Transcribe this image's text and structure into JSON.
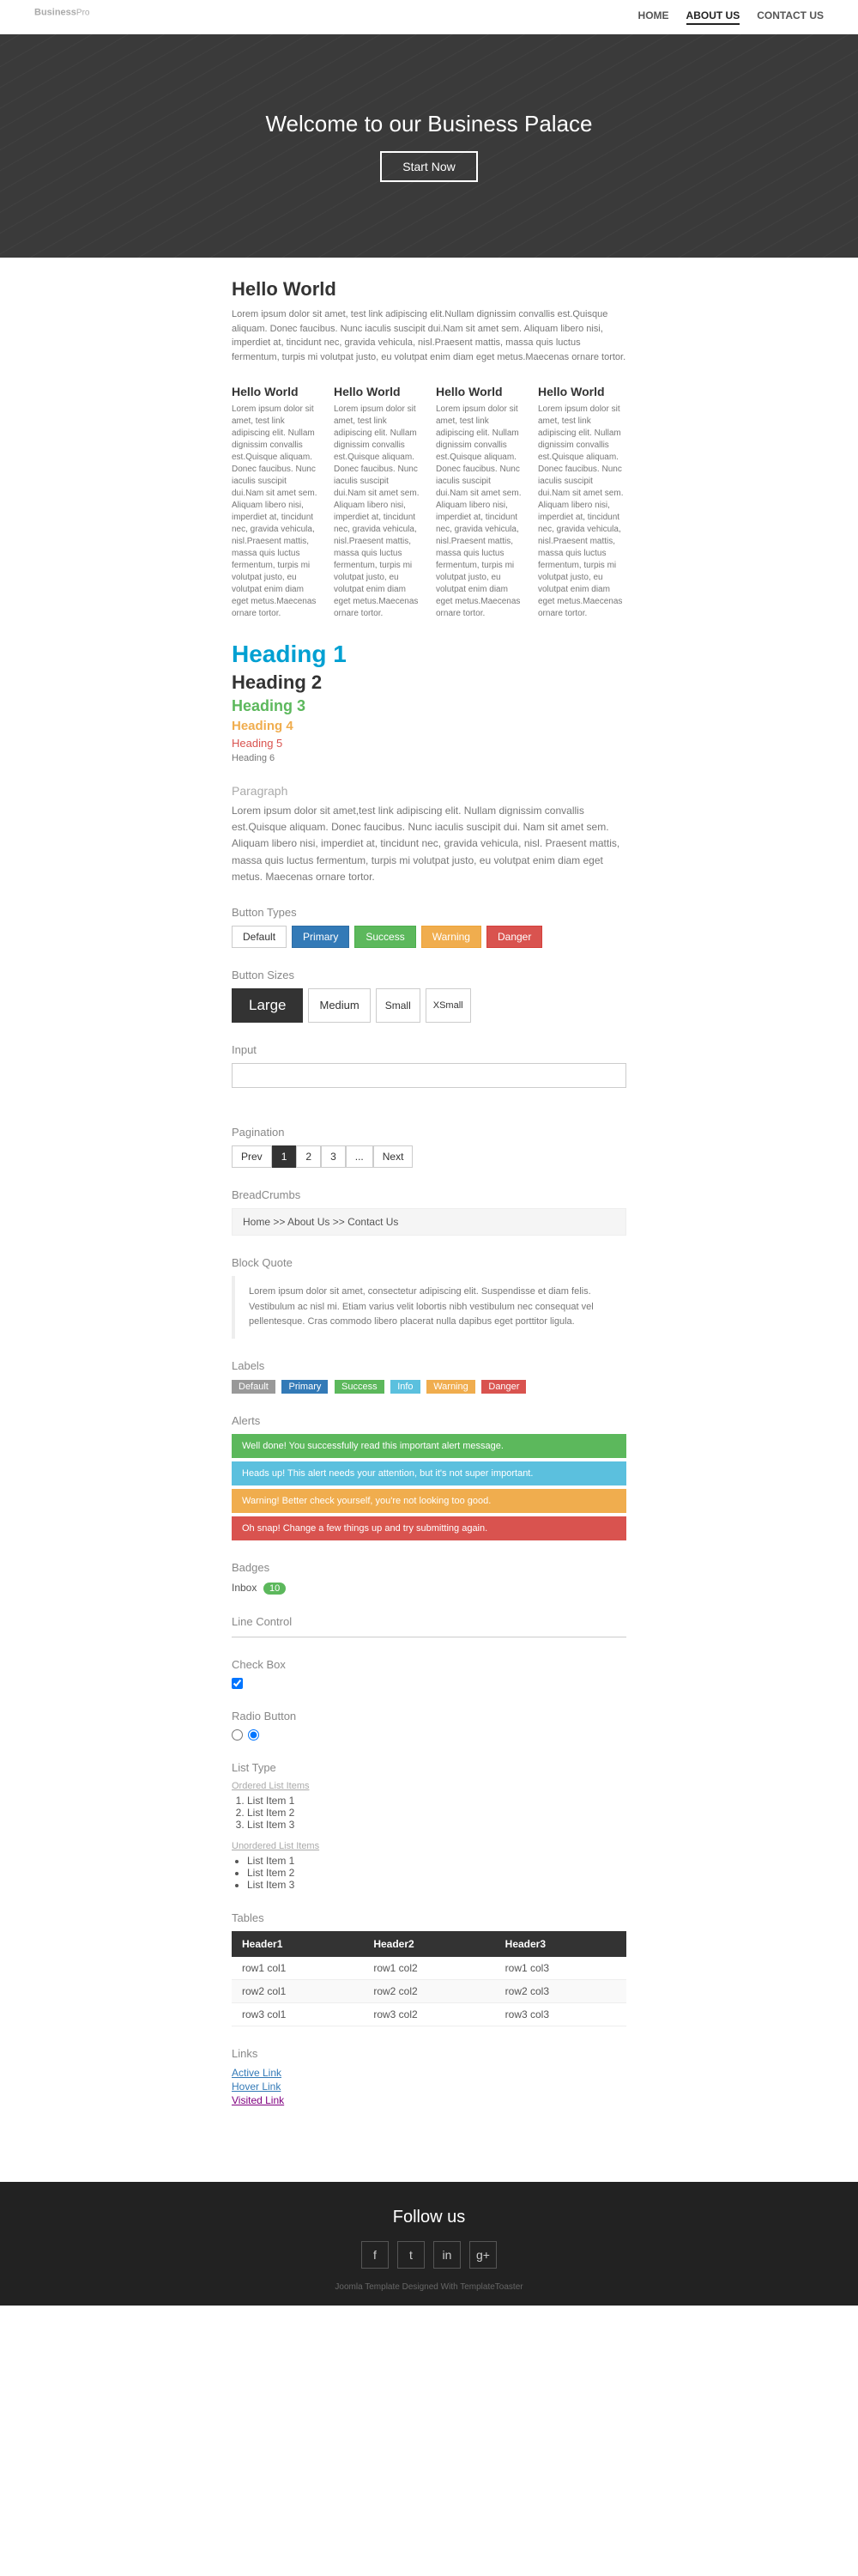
{
  "navbar": {
    "brand": "Business",
    "brand_sup": "Pro",
    "nav_items": [
      {
        "label": "HOME",
        "active": false
      },
      {
        "label": "ABOUT US",
        "active": true
      },
      {
        "label": "CONTACT US",
        "active": false
      }
    ]
  },
  "hero": {
    "title": "Welcome to our Business Palace",
    "button_label": "Start Now"
  },
  "hello_world": {
    "title": "Hello World",
    "intro_text": "Lorem ipsum dolor sit amet, test link adipiscing elit.Nullam dignissim convallis est.Quisque aliquam. Donec faucibus. Nunc iaculis suscipit dui.Nam sit amet sem. Aliquam libero nisi, imperdiet at, tincidunt nec, gravida vehicula, nisl.Praesent mattis, massa quis luctus fermentum, turpis mi volutpat justo, eu volutpat enim diam eget metus.Maecenas ornare tortor.",
    "columns": [
      {
        "title": "Hello World",
        "text": "Lorem ipsum dolor sit amet, test link adipiscing elit. Nullam dignissim convallis est.Quisque aliquam. Donec faucibus. Nunc iaculis suscipit dui.Nam sit amet sem. Aliquam libero nisi, imperdiet at, tincidunt nec, gravida vehicula, nisl.Praesent mattis, massa quis luctus fermentum, turpis mi volutpat justo, eu volutpat enim diam eget metus.Maecenas ornare tortor."
      },
      {
        "title": "Hello World",
        "text": "Lorem ipsum dolor sit amet, test link adipiscing elit. Nullam dignissim convallis est.Quisque aliquam. Donec faucibus. Nunc iaculis suscipit dui.Nam sit amet sem. Aliquam libero nisi, imperdiet at, tincidunt nec, gravida vehicula, nisl.Praesent mattis, massa quis luctus fermentum, turpis mi volutpat justo, eu volutpat enim diam eget metus.Maecenas ornare tortor."
      },
      {
        "title": "Hello World",
        "text": "Lorem ipsum dolor sit amet, test link adipiscing elit. Nullam dignissim convallis est.Quisque aliquam. Donec faucibus. Nunc iaculis suscipit dui.Nam sit amet sem. Aliquam libero nisi, imperdiet at, tincidunt nec, gravida vehicula, nisl.Praesent mattis, massa quis luctus fermentum, turpis mi volutpat justo, eu volutpat enim diam eget metus.Maecenas ornare tortor."
      },
      {
        "title": "Hello World",
        "text": "Lorem ipsum dolor sit amet, test link adipiscing elit. Nullam dignissim convallis est.Quisque aliquam. Donec faucibus. Nunc iaculis suscipit dui.Nam sit amet sem. Aliquam libero nisi, imperdiet at, tincidunt nec, gravida vehicula, nisl.Praesent mattis, massa quis luctus fermentum, turpis mi volutpat justo, eu volutpat enim diam eget metus.Maecenas ornare tortor."
      }
    ]
  },
  "headings": {
    "h1": "Heading 1",
    "h2": "Heading 2",
    "h3": "Heading 3",
    "h4": "Heading 4",
    "h5": "Heading 5",
    "h6": "Heading 6"
  },
  "paragraph": {
    "label": "Paragraph",
    "text": "Lorem ipsum dolor sit amet,test link adipiscing elit. Nullam dignissim convallis est.Quisque aliquam. Donec faucibus. Nunc iaculis suscipit dui. Nam sit amet sem. Aliquam libero nisi, imperdiet at, tincidunt nec, gravida vehicula, nisl. Praesent mattis, massa quis luctus fermentum, turpis mi volutpat justo, eu volutpat enim diam eget metus. Maecenas ornare tortor."
  },
  "button_types": {
    "label": "Button Types",
    "buttons": [
      {
        "label": "Default",
        "type": "default"
      },
      {
        "label": "Primary",
        "type": "primary"
      },
      {
        "label": "Success",
        "type": "success"
      },
      {
        "label": "Warning",
        "type": "warning"
      },
      {
        "label": "Danger",
        "type": "danger"
      }
    ]
  },
  "button_sizes": {
    "label": "Button Sizes",
    "buttons": [
      {
        "label": "Large",
        "size": "lg"
      },
      {
        "label": "Medium",
        "size": "md"
      },
      {
        "label": "Small",
        "size": "sm"
      },
      {
        "label": "XSmall",
        "size": "xs"
      }
    ]
  },
  "input_section": {
    "label": "Input",
    "placeholder": ""
  },
  "pagination": {
    "label": "Pagination",
    "prev": "Prev",
    "next": "Next",
    "pages": [
      "1",
      "2",
      "3",
      "..."
    ]
  },
  "breadcrumbs": {
    "label": "BreadCrumbs",
    "path": "Home >> About Us >> Contact Us"
  },
  "block_quote": {
    "label": "Block Quote",
    "text": "Lorem ipsum dolor sit amet, consectetur adipiscing elit. Suspendisse et diam felis. Vestibulum ac nisl mi. Etiam varius velit lobortis nibh vestibulum nec consequat vel pellentesque. Cras commodo libero placerat nulla dapibus eget porttitor ligula."
  },
  "labels_section": {
    "label": "Labels",
    "items": [
      {
        "text": "Default",
        "type": "default"
      },
      {
        "text": "Primary",
        "type": "primary"
      },
      {
        "text": "Success",
        "type": "success"
      },
      {
        "text": "Info",
        "type": "info"
      },
      {
        "text": "Warning",
        "type": "warning"
      },
      {
        "text": "Danger",
        "type": "danger"
      }
    ]
  },
  "alerts": {
    "label": "Alerts",
    "items": [
      {
        "text": "Well done! You successfully read this important alert message.",
        "type": "success"
      },
      {
        "text": "Heads up! This alert needs your attention, but it's not super important.",
        "type": "info"
      },
      {
        "text": "Warning! Better check yourself, you're not looking too good.",
        "type": "warning"
      },
      {
        "text": "Oh snap! Change a few things up and try submitting again.",
        "type": "danger"
      }
    ]
  },
  "badges": {
    "label": "Badges",
    "inbox_label": "Inbox",
    "inbox_count": "10"
  },
  "line_control": {
    "label": "Line Control"
  },
  "checkbox_section": {
    "label": "Check Box",
    "checked": true
  },
  "radio_section": {
    "label": "Radio Button",
    "option1": "unchecked",
    "option2": "checked"
  },
  "list_type": {
    "label": "List Type",
    "ordered_label": "Ordered List Items",
    "ordered_items": [
      "List Item 1",
      "List Item 2",
      "List Item 3"
    ],
    "unordered_label": "Unordered List Items",
    "unordered_items": [
      "List Item 1",
      "List Item 2",
      "List Item 3"
    ]
  },
  "tables": {
    "label": "Tables",
    "headers": [
      "Header1",
      "Header2",
      "Header3"
    ],
    "rows": [
      [
        "row1 col1",
        "row1 col2",
        "row1 col3"
      ],
      [
        "row2 col1",
        "row2 col2",
        "row2 col3"
      ],
      [
        "row3 col1",
        "row3 col2",
        "row3 col3"
      ]
    ]
  },
  "links": {
    "label": "Links",
    "active": "Active Link",
    "hover": "Hover Link",
    "visited": "Visited Link"
  },
  "footer": {
    "follow_us": "Follow us",
    "credit": "Joomla Template Designed With TemplateToaster",
    "icons": [
      "f",
      "t",
      "in",
      "g+"
    ]
  }
}
